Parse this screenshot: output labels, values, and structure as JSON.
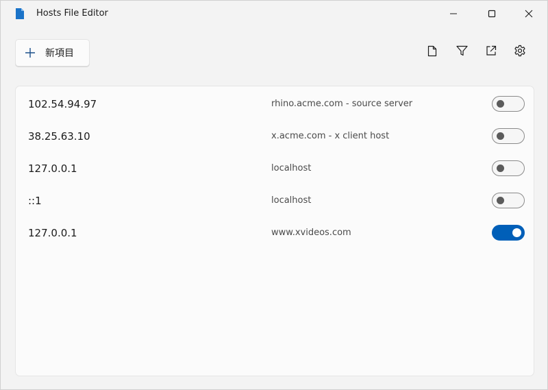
{
  "window": {
    "title": "Hosts File Editor"
  },
  "toolbar": {
    "new_entry_label": "新項目"
  },
  "icons": {
    "app": "document-icon",
    "minimize": "minimize-icon",
    "maximize": "maximize-icon",
    "close": "close-icon",
    "add": "plus-icon",
    "file": "file-icon",
    "filter": "filter-icon",
    "open": "open-external-icon",
    "settings": "gear-icon"
  },
  "colors": {
    "accent": "#005fb8",
    "background": "#f3f3f3",
    "card": "#fbfbfb"
  },
  "entries": [
    {
      "ip": "102.54.94.97",
      "host": "rhino.acme.com - source server",
      "enabled": false
    },
    {
      "ip": "38.25.63.10",
      "host": "x.acme.com - x client host",
      "enabled": false
    },
    {
      "ip": "127.0.0.1",
      "host": "localhost",
      "enabled": false
    },
    {
      "ip": "::1",
      "host": "localhost",
      "enabled": false
    },
    {
      "ip": "127.0.0.1",
      "host": "www.xvideos.com",
      "enabled": true
    }
  ]
}
